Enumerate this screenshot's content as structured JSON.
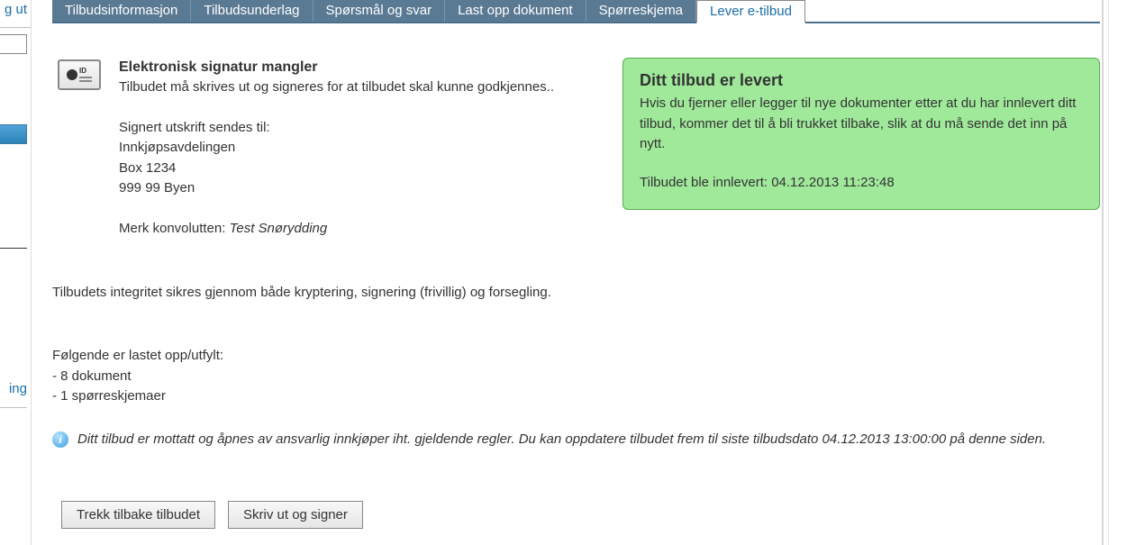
{
  "side": {
    "frag1": "g ut",
    "frag2": "ing"
  },
  "tabs": [
    {
      "label": "Tilbudsinformasjon",
      "active": false
    },
    {
      "label": "Tilbudsunderlag",
      "active": false
    },
    {
      "label": "Spørsmål og svar",
      "active": false
    },
    {
      "label": "Last opp dokument",
      "active": false
    },
    {
      "label": "Spørreskjema",
      "active": false
    },
    {
      "label": "Lever e-tilbud",
      "active": true
    }
  ],
  "signature": {
    "title": "Elektronisk signatur mangler",
    "desc": "Tilbudet må skrives ut og signeres for at tilbudet skal kunne godkjennes..",
    "send_to_label": "Signert utskrift sendes til:",
    "addr1": "Innkjøpsavdelingen",
    "addr2": "Box 1234",
    "addr3": "999 99 Byen",
    "envelope_label": "Merk konvolutten: ",
    "envelope_value": "Test Snørydding"
  },
  "status": {
    "title": "Ditt tilbud er levert",
    "body": "Hvis du fjerner eller legger til nye dokumenter etter at du har innlevert ditt tilbud, kommer det til å bli trukket tilbake, slik at du må sende det inn på nytt.",
    "submitted_label": "Tilbudet ble innlevert: ",
    "submitted_ts": "04.12.2013 11:23:48"
  },
  "integrity": "Tilbudets integritet sikres gjennom både kryptering, signering (frivillig) og forsegling.",
  "uploaded": {
    "heading": "Følgende er lastet opp/utfylt:",
    "items": [
      "- 8 dokument",
      "- 1 spørreskjemaer"
    ]
  },
  "info": "Ditt tilbud er mottatt og åpnes av ansvarlig innkjøper iht. gjeldende regler. Du kan oppdatere tilbudet frem til siste tilbudsdato 04.12.2013 13:00:00 på denne siden.",
  "buttons": {
    "withdraw": "Trekk tilbake tilbudet",
    "print_sign": "Skriv ut og signer"
  }
}
